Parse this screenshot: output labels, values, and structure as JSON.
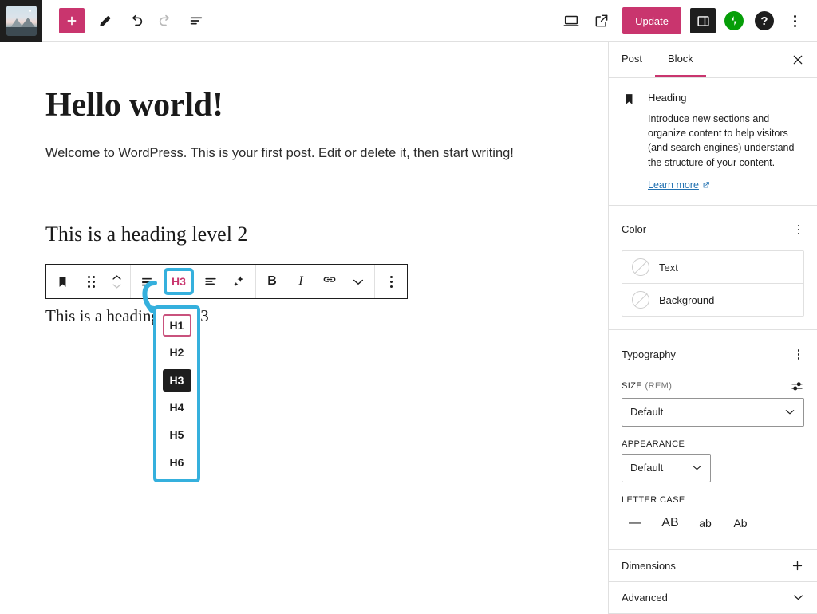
{
  "topbar": {
    "site_thumb_alt": "site-icon",
    "add_block_label": "+",
    "tools": [
      {
        "name": "add-block-button",
        "label": "+"
      },
      {
        "name": "edit-tool-button",
        "label": "Tools"
      },
      {
        "name": "undo-button",
        "label": "Undo"
      },
      {
        "name": "redo-button",
        "label": "Redo"
      },
      {
        "name": "document-overview-button",
        "label": "Document Overview"
      }
    ],
    "preview_label": "Preview",
    "view_post_label": "View Post",
    "update_label": "Update",
    "sidebar_toggle_label": "Settings",
    "jetpack_label": "Jetpack",
    "help_label": "?",
    "options_label": "Options"
  },
  "editor": {
    "post_title": "Hello world!",
    "paragraph": "Welcome to WordPress. This is your first post. Edit or delete it, then start writing!",
    "heading_2": "This is a heading level 2",
    "heading_3": "This is a heading level 3"
  },
  "block_toolbar": {
    "block_type_label": "Heading",
    "drag_label": "Drag",
    "move_up_label": "Move up",
    "move_down_label": "Move down",
    "transform_label": "Paragraph",
    "heading_level_label": "H3",
    "align_label": "Align text",
    "ai_label": "AI Assistant",
    "bold_label": "B",
    "italic_label": "I",
    "link_label": "Link",
    "more_rich_text_label": "More",
    "options_label": "Options"
  },
  "heading_levels": {
    "items": [
      {
        "label": "H1",
        "state": "focused"
      },
      {
        "label": "H2",
        "state": "normal"
      },
      {
        "label": "H3",
        "state": "selected"
      },
      {
        "label": "H4",
        "state": "normal"
      },
      {
        "label": "H5",
        "state": "normal"
      },
      {
        "label": "H6",
        "state": "normal"
      }
    ]
  },
  "sidebar": {
    "tabs": [
      {
        "label": "Post",
        "active": false
      },
      {
        "label": "Block",
        "active": true
      }
    ],
    "close_label": "Close settings",
    "block": {
      "name": "Heading",
      "description": "Introduce new sections and organize content to help visitors (and search engines) understand the structure of your content.",
      "learn_more": "Learn more"
    },
    "color": {
      "title": "Color",
      "rows": [
        {
          "label": "Text",
          "value": "none"
        },
        {
          "label": "Background",
          "value": "none"
        }
      ]
    },
    "typography": {
      "title": "Typography",
      "size_label": "SIZE",
      "size_unit": "(REM)",
      "size_value": "Default",
      "appearance_label": "APPEARANCE",
      "appearance_value": "Default",
      "letter_case_label": "LETTER CASE",
      "case_options": [
        "—",
        "AB",
        "ab",
        "Ab"
      ]
    },
    "dimensions": {
      "title": "Dimensions"
    },
    "advanced": {
      "title": "Advanced"
    }
  },
  "colors": {
    "accent": "#c9356e",
    "highlight": "#35b0dd",
    "jetpack_green": "#069e08",
    "link_blue": "#2271b1",
    "dark": "#1e1e1e"
  }
}
